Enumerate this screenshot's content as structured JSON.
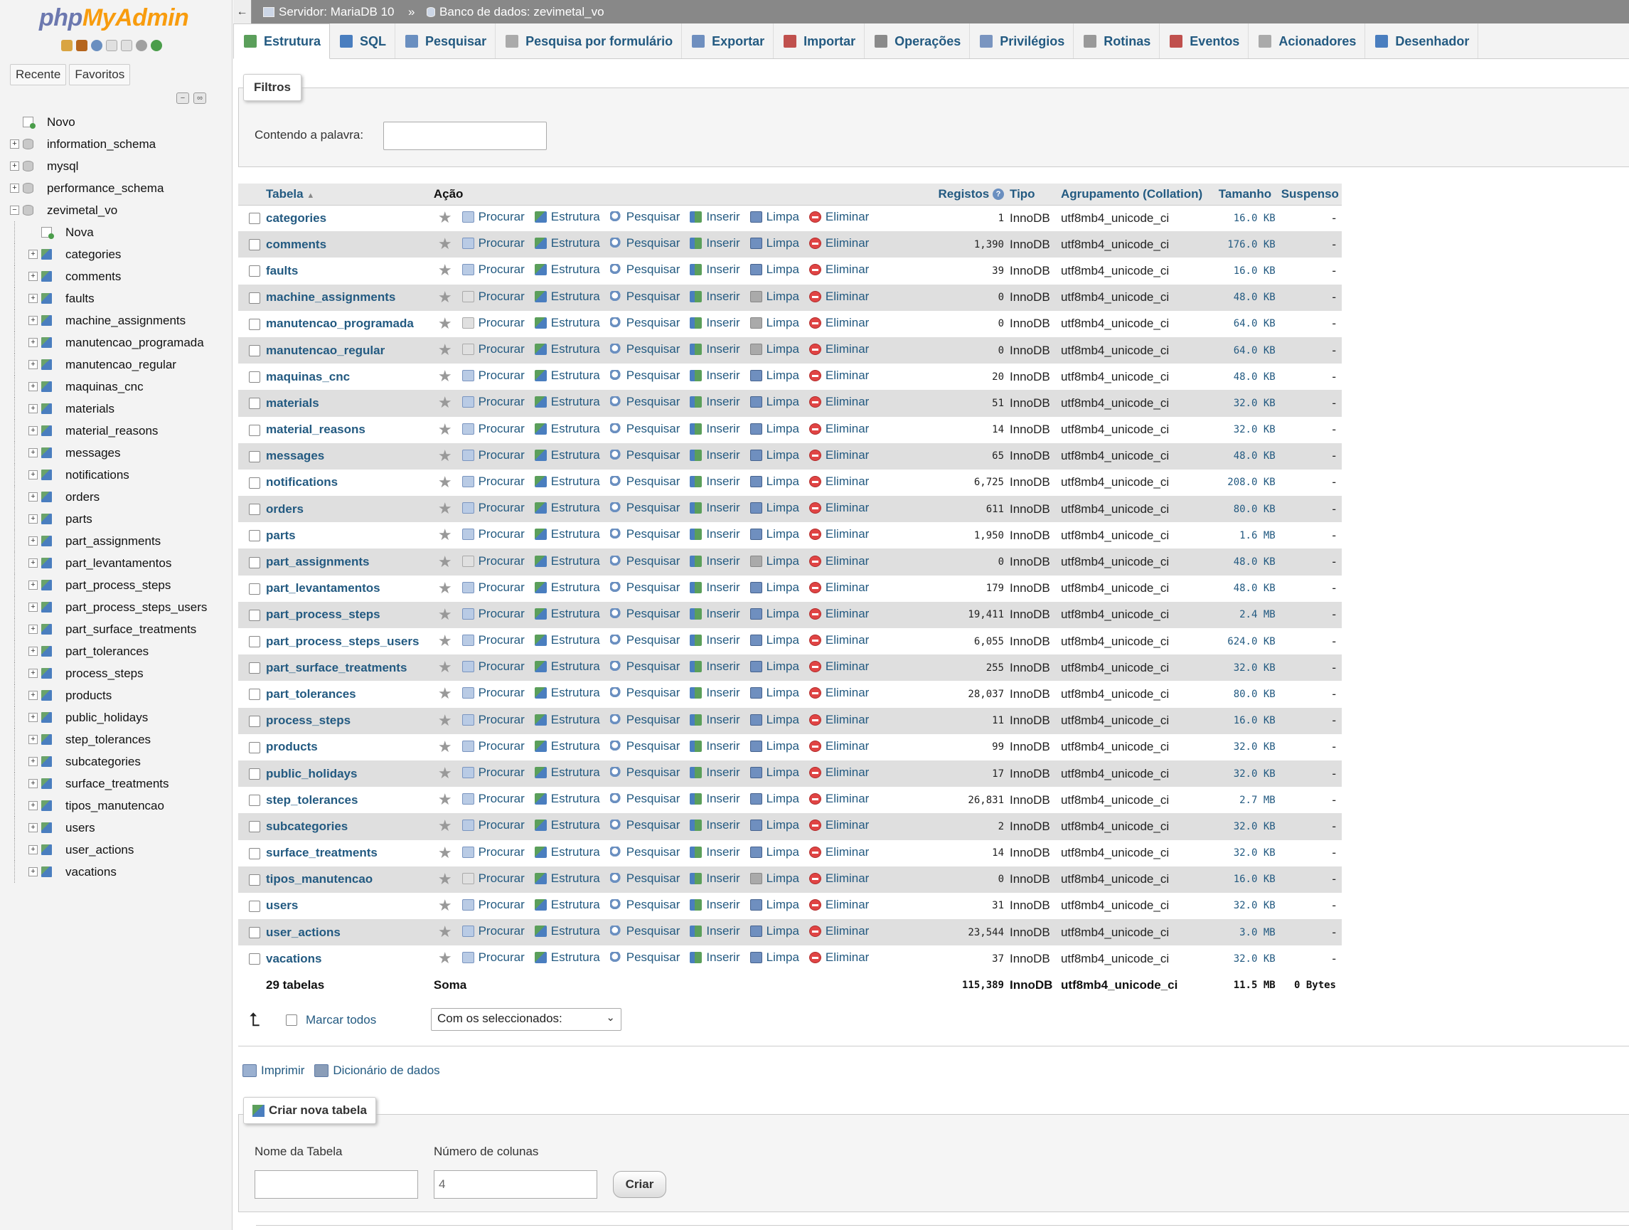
{
  "nav": {
    "logo_php": "php",
    "logo_myadmin": "MyAdmin",
    "tab_recent": "Recente",
    "tab_favorites": "Favoritos",
    "tree": [
      {
        "label": "Novo",
        "level": 0,
        "icon": "new",
        "exp": ""
      },
      {
        "label": "information_schema",
        "level": 0,
        "icon": "db",
        "exp": "+"
      },
      {
        "label": "mysql",
        "level": 0,
        "icon": "db",
        "exp": "+"
      },
      {
        "label": "performance_schema",
        "level": 0,
        "icon": "db",
        "exp": "+"
      },
      {
        "label": "zevimetal_vo",
        "level": 0,
        "icon": "db",
        "exp": "−"
      },
      {
        "label": "Nova",
        "level": 1,
        "icon": "new",
        "exp": ""
      },
      {
        "label": "categories",
        "level": 1,
        "icon": "tbl",
        "exp": "+"
      },
      {
        "label": "comments",
        "level": 1,
        "icon": "tbl",
        "exp": "+"
      },
      {
        "label": "faults",
        "level": 1,
        "icon": "tbl",
        "exp": "+"
      },
      {
        "label": "machine_assignments",
        "level": 1,
        "icon": "tbl",
        "exp": "+"
      },
      {
        "label": "manutencao_programada",
        "level": 1,
        "icon": "tbl",
        "exp": "+"
      },
      {
        "label": "manutencao_regular",
        "level": 1,
        "icon": "tbl",
        "exp": "+"
      },
      {
        "label": "maquinas_cnc",
        "level": 1,
        "icon": "tbl",
        "exp": "+"
      },
      {
        "label": "materials",
        "level": 1,
        "icon": "tbl",
        "exp": "+"
      },
      {
        "label": "material_reasons",
        "level": 1,
        "icon": "tbl",
        "exp": "+"
      },
      {
        "label": "messages",
        "level": 1,
        "icon": "tbl",
        "exp": "+"
      },
      {
        "label": "notifications",
        "level": 1,
        "icon": "tbl",
        "exp": "+"
      },
      {
        "label": "orders",
        "level": 1,
        "icon": "tbl",
        "exp": "+"
      },
      {
        "label": "parts",
        "level": 1,
        "icon": "tbl",
        "exp": "+"
      },
      {
        "label": "part_assignments",
        "level": 1,
        "icon": "tbl",
        "exp": "+"
      },
      {
        "label": "part_levantamentos",
        "level": 1,
        "icon": "tbl",
        "exp": "+"
      },
      {
        "label": "part_process_steps",
        "level": 1,
        "icon": "tbl",
        "exp": "+"
      },
      {
        "label": "part_process_steps_users",
        "level": 1,
        "icon": "tbl",
        "exp": "+"
      },
      {
        "label": "part_surface_treatments",
        "level": 1,
        "icon": "tbl",
        "exp": "+"
      },
      {
        "label": "part_tolerances",
        "level": 1,
        "icon": "tbl",
        "exp": "+"
      },
      {
        "label": "process_steps",
        "level": 1,
        "icon": "tbl",
        "exp": "+"
      },
      {
        "label": "products",
        "level": 1,
        "icon": "tbl",
        "exp": "+"
      },
      {
        "label": "public_holidays",
        "level": 1,
        "icon": "tbl",
        "exp": "+"
      },
      {
        "label": "step_tolerances",
        "level": 1,
        "icon": "tbl",
        "exp": "+"
      },
      {
        "label": "subcategories",
        "level": 1,
        "icon": "tbl",
        "exp": "+"
      },
      {
        "label": "surface_treatments",
        "level": 1,
        "icon": "tbl",
        "exp": "+"
      },
      {
        "label": "tipos_manutencao",
        "level": 1,
        "icon": "tbl",
        "exp": "+"
      },
      {
        "label": "users",
        "level": 1,
        "icon": "tbl",
        "exp": "+"
      },
      {
        "label": "user_actions",
        "level": 1,
        "icon": "tbl",
        "exp": "+"
      },
      {
        "label": "vacations",
        "level": 1,
        "icon": "tbl",
        "exp": "+"
      }
    ]
  },
  "breadcrumb": {
    "server": "Servidor: MariaDB 10",
    "separator": "»",
    "database": "Banco de dados: zevimetal_vo"
  },
  "tabs": [
    {
      "label": "Estrutura",
      "icon": "structure-icon",
      "active": true
    },
    {
      "label": "SQL",
      "icon": "sql-icon"
    },
    {
      "label": "Pesquisar",
      "icon": "search-icon"
    },
    {
      "label": "Pesquisa por formulário",
      "icon": "query-icon"
    },
    {
      "label": "Exportar",
      "icon": "export-icon"
    },
    {
      "label": "Importar",
      "icon": "import-icon"
    },
    {
      "label": "Operações",
      "icon": "wrench-icon"
    },
    {
      "label": "Privilégios",
      "icon": "privileges-icon"
    },
    {
      "label": "Rotinas",
      "icon": "routines-icon"
    },
    {
      "label": "Eventos",
      "icon": "clock-icon"
    },
    {
      "label": "Acionadores",
      "icon": "triggers-icon"
    },
    {
      "label": "Desenhador",
      "icon": "designer-icon"
    }
  ],
  "filters": {
    "legend": "Filtros",
    "label": "Contendo a palavra:",
    "value": ""
  },
  "table": {
    "headers": {
      "table": "Tabela",
      "action": "Ação",
      "rows": "Registos",
      "type": "Tipo",
      "collation": "Agrupamento (Collation)",
      "size": "Tamanho",
      "overhead": "Suspenso"
    },
    "actions": {
      "browse": "Procurar",
      "structure": "Estrutura",
      "search": "Pesquisar",
      "insert": "Inserir",
      "empty": "Limpa",
      "drop": "Eliminar"
    },
    "rows": [
      {
        "name": "categories",
        "rows": "1",
        "type": "InnoDB",
        "collation": "utf8mb4_unicode_ci",
        "size": "16.0 KB",
        "overhead": "-"
      },
      {
        "name": "comments",
        "rows": "1,390",
        "type": "InnoDB",
        "collation": "utf8mb4_unicode_ci",
        "size": "176.0 KB",
        "overhead": "-"
      },
      {
        "name": "faults",
        "rows": "39",
        "type": "InnoDB",
        "collation": "utf8mb4_unicode_ci",
        "size": "16.0 KB",
        "overhead": "-"
      },
      {
        "name": "machine_assignments",
        "rows": "0",
        "type": "InnoDB",
        "collation": "utf8mb4_unicode_ci",
        "size": "48.0 KB",
        "overhead": "-"
      },
      {
        "name": "manutencao_programada",
        "rows": "0",
        "type": "InnoDB",
        "collation": "utf8mb4_unicode_ci",
        "size": "64.0 KB",
        "overhead": "-"
      },
      {
        "name": "manutencao_regular",
        "rows": "0",
        "type": "InnoDB",
        "collation": "utf8mb4_unicode_ci",
        "size": "64.0 KB",
        "overhead": "-"
      },
      {
        "name": "maquinas_cnc",
        "rows": "20",
        "type": "InnoDB",
        "collation": "utf8mb4_unicode_ci",
        "size": "48.0 KB",
        "overhead": "-"
      },
      {
        "name": "materials",
        "rows": "51",
        "type": "InnoDB",
        "collation": "utf8mb4_unicode_ci",
        "size": "32.0 KB",
        "overhead": "-"
      },
      {
        "name": "material_reasons",
        "rows": "14",
        "type": "InnoDB",
        "collation": "utf8mb4_unicode_ci",
        "size": "32.0 KB",
        "overhead": "-"
      },
      {
        "name": "messages",
        "rows": "65",
        "type": "InnoDB",
        "collation": "utf8mb4_unicode_ci",
        "size": "48.0 KB",
        "overhead": "-"
      },
      {
        "name": "notifications",
        "rows": "6,725",
        "type": "InnoDB",
        "collation": "utf8mb4_unicode_ci",
        "size": "208.0 KB",
        "overhead": "-"
      },
      {
        "name": "orders",
        "rows": "611",
        "type": "InnoDB",
        "collation": "utf8mb4_unicode_ci",
        "size": "80.0 KB",
        "overhead": "-"
      },
      {
        "name": "parts",
        "rows": "1,950",
        "type": "InnoDB",
        "collation": "utf8mb4_unicode_ci",
        "size": "1.6 MB",
        "overhead": "-"
      },
      {
        "name": "part_assignments",
        "rows": "0",
        "type": "InnoDB",
        "collation": "utf8mb4_unicode_ci",
        "size": "48.0 KB",
        "overhead": "-"
      },
      {
        "name": "part_levantamentos",
        "rows": "179",
        "type": "InnoDB",
        "collation": "utf8mb4_unicode_ci",
        "size": "48.0 KB",
        "overhead": "-"
      },
      {
        "name": "part_process_steps",
        "rows": "19,411",
        "type": "InnoDB",
        "collation": "utf8mb4_unicode_ci",
        "size": "2.4 MB",
        "overhead": "-"
      },
      {
        "name": "part_process_steps_users",
        "rows": "6,055",
        "type": "InnoDB",
        "collation": "utf8mb4_unicode_ci",
        "size": "624.0 KB",
        "overhead": "-"
      },
      {
        "name": "part_surface_treatments",
        "rows": "255",
        "type": "InnoDB",
        "collation": "utf8mb4_unicode_ci",
        "size": "32.0 KB",
        "overhead": "-"
      },
      {
        "name": "part_tolerances",
        "rows": "28,037",
        "type": "InnoDB",
        "collation": "utf8mb4_unicode_ci",
        "size": "80.0 KB",
        "overhead": "-"
      },
      {
        "name": "process_steps",
        "rows": "11",
        "type": "InnoDB",
        "collation": "utf8mb4_unicode_ci",
        "size": "16.0 KB",
        "overhead": "-"
      },
      {
        "name": "products",
        "rows": "99",
        "type": "InnoDB",
        "collation": "utf8mb4_unicode_ci",
        "size": "32.0 KB",
        "overhead": "-"
      },
      {
        "name": "public_holidays",
        "rows": "17",
        "type": "InnoDB",
        "collation": "utf8mb4_unicode_ci",
        "size": "32.0 KB",
        "overhead": "-"
      },
      {
        "name": "step_tolerances",
        "rows": "26,831",
        "type": "InnoDB",
        "collation": "utf8mb4_unicode_ci",
        "size": "2.7 MB",
        "overhead": "-"
      },
      {
        "name": "subcategories",
        "rows": "2",
        "type": "InnoDB",
        "collation": "utf8mb4_unicode_ci",
        "size": "32.0 KB",
        "overhead": "-"
      },
      {
        "name": "surface_treatments",
        "rows": "14",
        "type": "InnoDB",
        "collation": "utf8mb4_unicode_ci",
        "size": "32.0 KB",
        "overhead": "-"
      },
      {
        "name": "tipos_manutencao",
        "rows": "0",
        "type": "InnoDB",
        "collation": "utf8mb4_unicode_ci",
        "size": "16.0 KB",
        "overhead": "-"
      },
      {
        "name": "users",
        "rows": "31",
        "type": "InnoDB",
        "collation": "utf8mb4_unicode_ci",
        "size": "32.0 KB",
        "overhead": "-"
      },
      {
        "name": "user_actions",
        "rows": "23,544",
        "type": "InnoDB",
        "collation": "utf8mb4_unicode_ci",
        "size": "3.0 MB",
        "overhead": "-"
      },
      {
        "name": "vacations",
        "rows": "37",
        "type": "InnoDB",
        "collation": "utf8mb4_unicode_ci",
        "size": "32.0 KB",
        "overhead": "-"
      }
    ],
    "footer": {
      "count": "29 tabelas",
      "sum": "Soma",
      "rows": "115,389",
      "type": "InnoDB",
      "collation": "utf8mb4_unicode_ci",
      "size": "11.5 MB",
      "overhead": "0 Bytes"
    }
  },
  "bulk": {
    "check_all": "Marcar todos",
    "with_selected": "Com os seleccionados:"
  },
  "links": {
    "print": "Imprimir",
    "data_dictionary": "Dicionário de dados"
  },
  "create": {
    "legend": "Criar nova tabela",
    "name_label": "Nome da Tabela",
    "name_value": "",
    "columns_label": "Número de colunas",
    "columns_value": "4",
    "button": "Criar"
  }
}
